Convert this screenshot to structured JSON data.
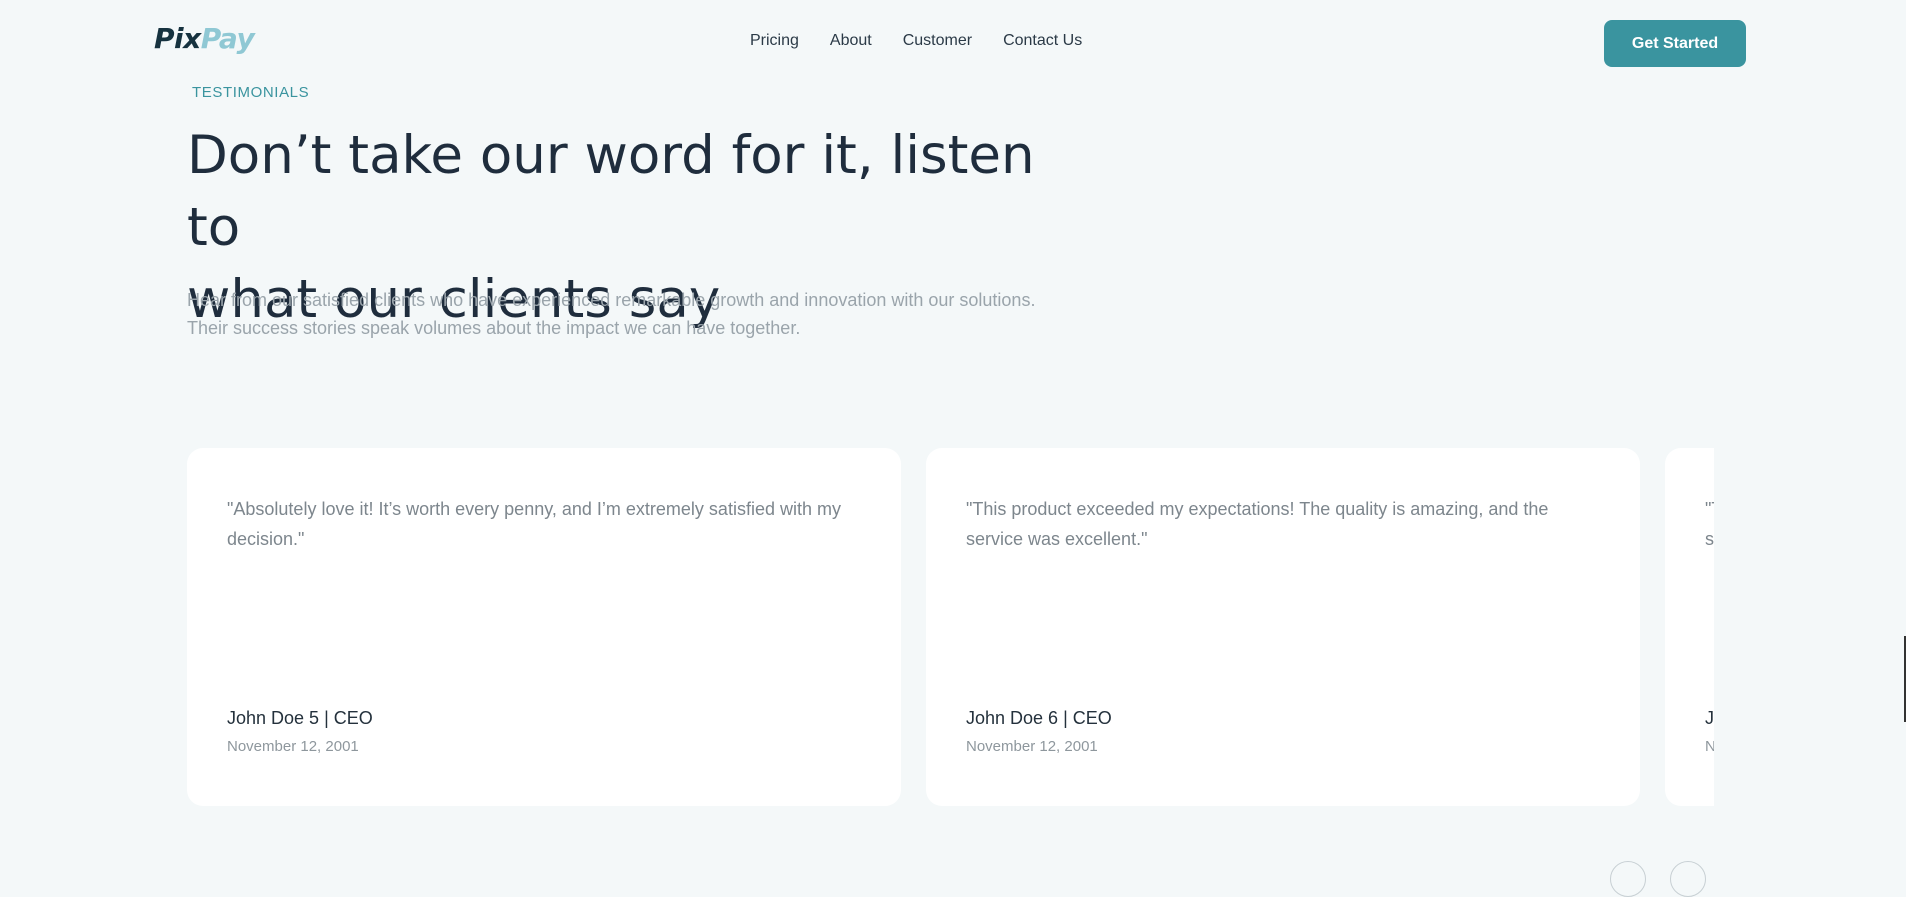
{
  "brand": {
    "logo_part1": "Pix",
    "logo_part2": "Pay",
    "primary_color": "#3a949f",
    "logo_accent_color": "#8fc8d4"
  },
  "nav": {
    "items": [
      {
        "label": "Pricing"
      },
      {
        "label": "About"
      },
      {
        "label": "Customer"
      },
      {
        "label": "Contact Us"
      }
    ],
    "cta_label": "Get Started"
  },
  "hero": {
    "eyebrow": "TESTIMONIALS",
    "headline_line1": "Don’t take our word for it, listen to",
    "headline_line2": "what our clients say",
    "subtext_line1": "Hear from our satisfied clients who have experienced remarkable growth and innovation with our solutions.",
    "subtext_line2": "Their success stories speak volumes about the impact we can have together."
  },
  "testimonials": [
    {
      "quote_line1": "\"Absolutely love it! It’s worth every penny, and I’m extremely satisfied with my",
      "quote_line2": "decision.\"",
      "author": "John Doe 5 | CEO",
      "date": "November 12, 2001"
    },
    {
      "quote_line1": "\"This product exceeded my expectations! The quality is amazing, and the",
      "quote_line2": "service was excellent.\"",
      "author": "John Doe 6 | CEO",
      "date": "November 12, 2001"
    },
    {
      "quote_line1": "\"T",
      "quote_line2": "s",
      "author": "J",
      "date": "N"
    }
  ],
  "controls": {
    "prev_icon": "chevron-left-icon",
    "next_icon": "chevron-right-icon"
  }
}
